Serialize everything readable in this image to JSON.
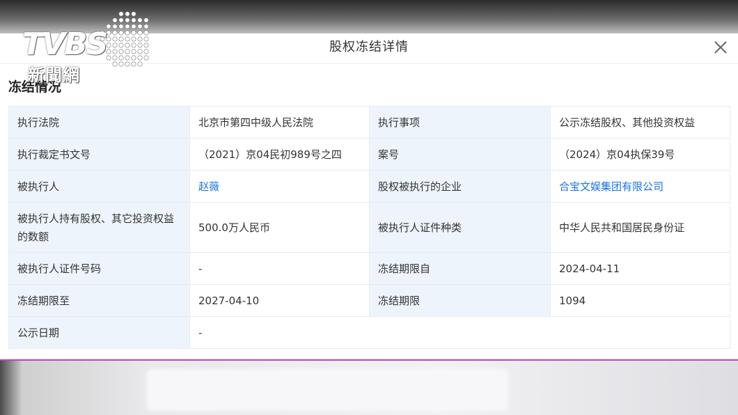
{
  "modal": {
    "title": "股权冻结详情",
    "section_title": "冻结情况"
  },
  "logo": {
    "brand": "TVBS",
    "subtitle": "新聞網"
  },
  "rows": [
    {
      "l1": "执行法院",
      "v1": "北京市第四中级人民法院",
      "l2": "执行事项",
      "v2": "公示冻结股权、其他投资权益"
    },
    {
      "l1": "执行裁定书文号",
      "v1": "（2021）京04民初989号之四",
      "l2": "案号",
      "v2": "（2024）京04执保39号"
    },
    {
      "l1": "被执行人",
      "v1": "赵薇",
      "l2": "股权被执行的企业",
      "v2": "合宝文娱集团有限公司"
    },
    {
      "l1": "被执行人持有股权、其它投资权益的数额",
      "v1": "500.0万人民币",
      "l2": "被执行人证件种类",
      "v2": "中华人民共和国居民身份证"
    },
    {
      "l1": "被执行人证件号码",
      "v1": "-",
      "l2": "冻结期限自",
      "v2": "2024-04-11"
    },
    {
      "l1": "冻结期限至",
      "v1": "2027-04-10",
      "l2": "冻结期限",
      "v2": "1094"
    },
    {
      "l1": "公示日期",
      "v1": "-"
    }
  ],
  "colors": {
    "label_bg": "#eef4fb",
    "link": "#1a73e8",
    "divider": "#c040c0"
  },
  "icons": {
    "close": "close-icon"
  }
}
